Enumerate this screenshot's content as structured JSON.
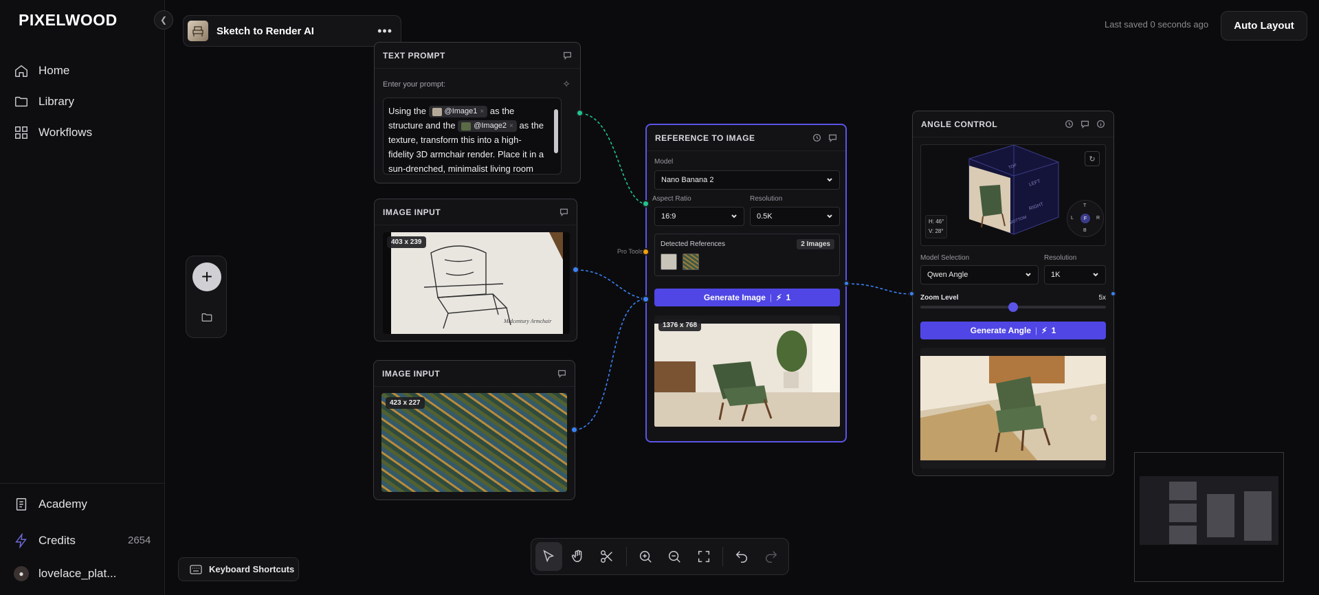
{
  "app": {
    "logo": "PIXELWOOD"
  },
  "sidebar": {
    "items": [
      {
        "label": "Home",
        "icon": "home-icon"
      },
      {
        "label": "Library",
        "icon": "folder-icon"
      },
      {
        "label": "Workflows",
        "icon": "grid-icon"
      }
    ],
    "bottom": {
      "academy": "Academy",
      "credits_label": "Credits",
      "credits_value": "2654",
      "user": "lovelace_plat..."
    }
  },
  "header": {
    "project_title": "Sketch to Render AI",
    "save_status": "Last saved 0 seconds ago",
    "auto_layout": "Auto Layout"
  },
  "nodes": {
    "text_prompt": {
      "title": "TEXT PROMPT",
      "prompt_label": "Enter your prompt:",
      "text_1": "Using the",
      "chip_1": "@Image1",
      "text_2": "as the structure and the",
      "chip_2": "@Image2",
      "text_3": "as the texture, transform this into a high-fidelity 3D armchair render. Place it in a sun-drenched, minimalist living room"
    },
    "image_input_1": {
      "title": "IMAGE INPUT",
      "dimensions": "403 x 239",
      "caption": "Midcentury Armchair"
    },
    "image_input_2": {
      "title": "IMAGE INPUT",
      "dimensions": "423 x 227"
    },
    "reference_to_image": {
      "title": "REFERENCE TO IMAGE",
      "model_label": "Model",
      "model_value": "Nano Banana 2",
      "aspect_label": "Aspect Ratio",
      "aspect_value": "16:9",
      "resolution_label": "Resolution",
      "resolution_value": "0.5K",
      "refs_label": "Detected References",
      "refs_count": "2 Images",
      "pro_tools": "Pro Tools",
      "button_label": "Generate Image",
      "button_cost": "1",
      "output_dimensions": "1376 x 768"
    },
    "angle_control": {
      "title": "ANGLE CONTROL",
      "h_angle": "H: 46°",
      "v_angle": "V: 28°",
      "cube_faces": [
        "LEFT",
        "RIGHT",
        "TOP",
        "BOTTOM"
      ],
      "compass": {
        "top": "T",
        "left": "L",
        "center": "F",
        "right": "R",
        "bottom": "B"
      },
      "model_selection_label": "Model Selection",
      "model_selection_value": "Qwen Angle",
      "resolution_label": "Resolution",
      "resolution_value": "1K",
      "zoom_label": "Zoom Level",
      "zoom_value": "5x",
      "zoom_fraction": 0.5,
      "button_label": "Generate Angle",
      "button_cost": "1"
    }
  },
  "toolbar": {
    "tools": [
      "pointer-icon",
      "hand-icon",
      "scissors-icon",
      "zoom-in-icon",
      "zoom-out-icon",
      "fit-screen-icon",
      "undo-icon",
      "redo-icon"
    ]
  },
  "keyboard_shortcuts": "Keyboard Shortcuts",
  "colors": {
    "accent": "#4f46e5",
    "port_green": "#22c38e",
    "port_blue": "#3b82f6",
    "port_orange": "#f59e0b"
  }
}
